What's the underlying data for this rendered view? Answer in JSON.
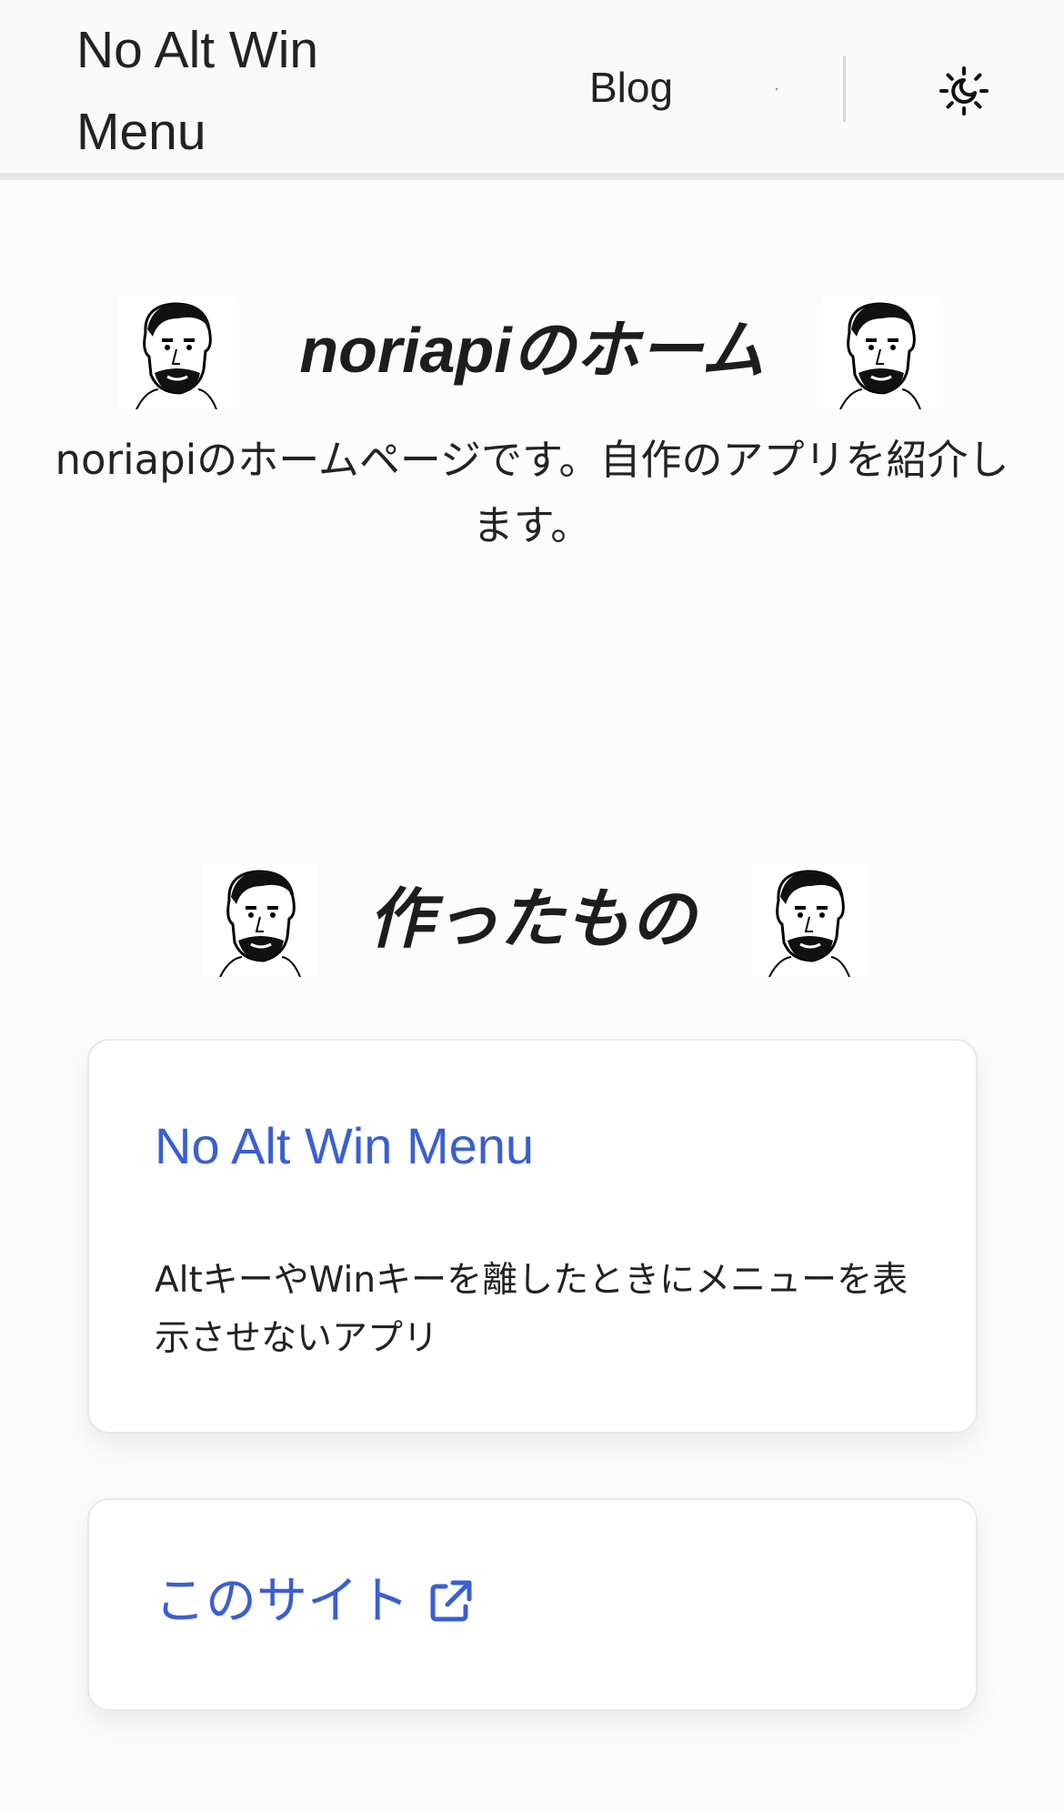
{
  "header": {
    "brand": "No Alt Win Menu",
    "nav_blog": "Blog",
    "theme_icon": "sun-moon-icon"
  },
  "hero": {
    "title_latin": "noriapi",
    "title_jp": "のホーム",
    "description": "noriapiのホームページです。自作のアプリを紹介します。",
    "avatar_icon": "portrait-avatar-icon"
  },
  "works": {
    "title": "作ったもの",
    "cards": [
      {
        "title": "No Alt Win Menu",
        "description": "AltキーやWinキーを離したときにメニューを表示させないアプリ"
      },
      {
        "title": "このサイト",
        "icon": "external-link-icon"
      }
    ]
  },
  "colors": {
    "link": "#3a5fd0",
    "text": "#1f1f1f",
    "background": "#fcfcfc",
    "card_border": "#e8e8e8"
  }
}
